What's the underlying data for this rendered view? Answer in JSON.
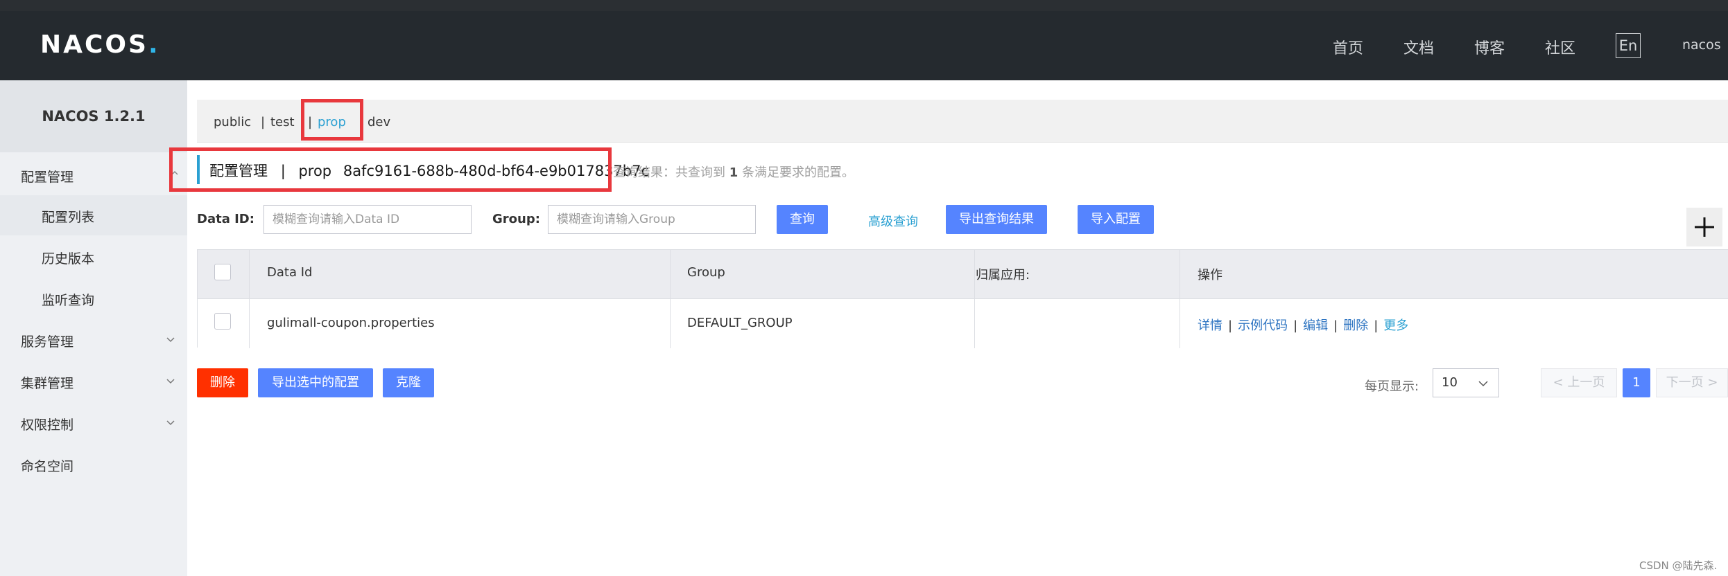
{
  "header": {
    "logo_text": "NACOS",
    "logo_dot": ".",
    "nav": [
      "首页",
      "文档",
      "博客",
      "社区"
    ],
    "lang": "En",
    "user": "nacos"
  },
  "sidebar": {
    "title": "NACOS 1.2.1",
    "items": [
      {
        "label": "配置管理"
      },
      {
        "label": "配置列表"
      },
      {
        "label": "历史版本"
      },
      {
        "label": "监听查询"
      },
      {
        "label": "服务管理"
      },
      {
        "label": "集群管理"
      },
      {
        "label": "权限控制"
      },
      {
        "label": "命名空间"
      }
    ]
  },
  "namespaces": {
    "public": "public",
    "sep1": "|",
    "test": "test",
    "sep2": "|",
    "prop": "prop",
    "dev": "dev"
  },
  "breadcrumb": {
    "title": "配置管理",
    "sep": "|",
    "namespace": "prop",
    "namespace_id": "8afc9161-688b-480d-bf64-e9b017837b7c",
    "result_prefix": "查询结果：共查询到",
    "result_count": "1",
    "result_suffix": "条满足要求的配置。"
  },
  "search": {
    "dataid_label": "Data ID:",
    "dataid_placeholder": "模糊查询请输入Data ID",
    "group_label": "Group:",
    "group_placeholder": "模糊查询请输入Group",
    "query_btn": "查询",
    "advanced_link": "高级查询",
    "export_btn": "导出查询结果",
    "import_btn": "导入配置"
  },
  "table": {
    "headers": [
      "Data Id",
      "Group",
      "归属应用:",
      "操作"
    ],
    "rows": [
      {
        "data_id": "gulimall-coupon.properties",
        "group": "DEFAULT_GROUP",
        "app": ""
      }
    ],
    "ops": {
      "detail": "详情",
      "sample": "示例代码",
      "edit": "编辑",
      "delete": "删除",
      "more": "更多",
      "sep": "|"
    }
  },
  "bottom": {
    "delete_btn": "删除",
    "export_selected_btn": "导出选中的配置",
    "clone_btn": "克隆"
  },
  "pagination": {
    "label": "每页显示:",
    "page_size": "10",
    "prev": "上一页",
    "current": "1",
    "next": "下一页"
  },
  "watermark": "CSDN @陆先森.",
  "colors": {
    "header_bg": "#252a2f",
    "primary": "#5584ff",
    "accent": "#2aa0d2",
    "danger": "#ff3000",
    "highlight": "#e8383d"
  }
}
